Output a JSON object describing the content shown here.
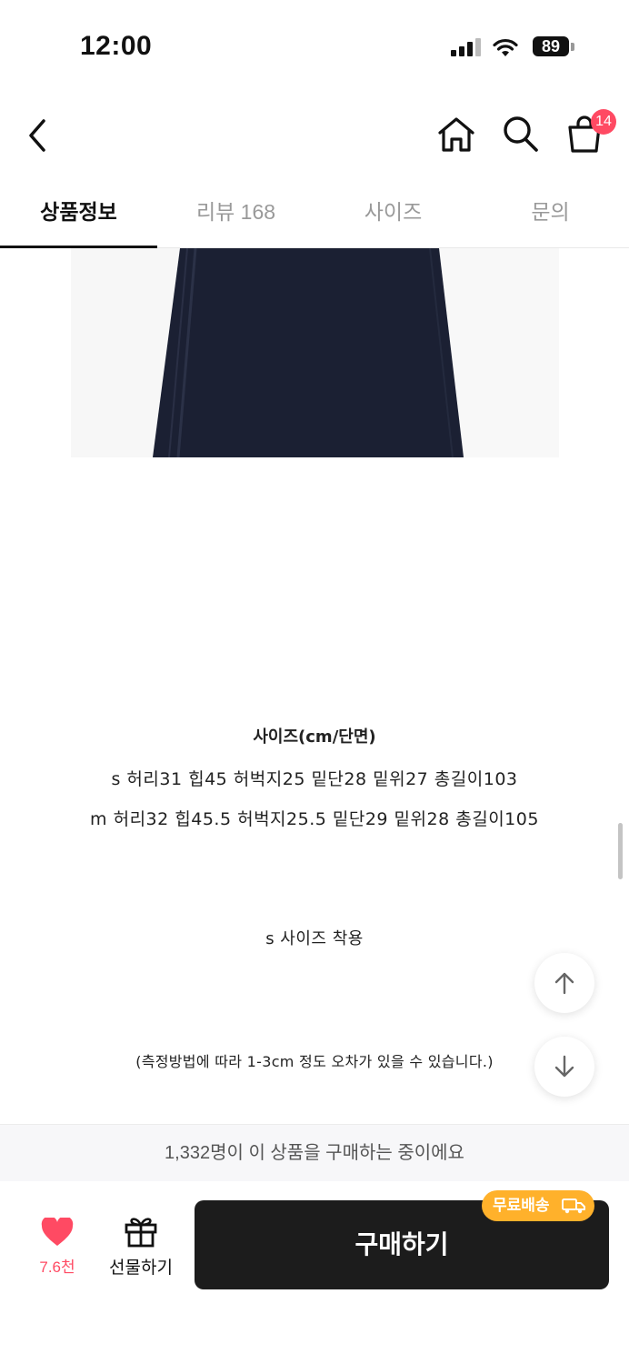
{
  "status_bar": {
    "time": "12:00",
    "battery": "89"
  },
  "header": {
    "cart_count": "14"
  },
  "tabs": [
    {
      "label": "상품정보",
      "active": true
    },
    {
      "label": "리뷰 168",
      "active": false
    },
    {
      "label": "사이즈",
      "active": false
    },
    {
      "label": "문의",
      "active": false
    }
  ],
  "content": {
    "size_title": "사이즈(cm/단면)",
    "size_rows": [
      "s 허리31 힙45 허벅지25 밑단28 밑위27 총길이103",
      "m 허리32 힙45.5 허벅지25.5 밑단29 밑위28 총길이105"
    ],
    "wearing_note": "s 사이즈 착용",
    "measure_note": "(측정방법에 따라 1-3cm 정도 오차가 있을 수 있습니다.)"
  },
  "purchase_notice": "1,332명이 이 상품을 구매하는 중이에요",
  "bottom_bar": {
    "like_count": "7.6천",
    "gift_label": "선물하기",
    "buy_label": "구매하기",
    "shipping_badge": "무료배송"
  },
  "colors": {
    "accent_pink": "#ff4a63",
    "shipping_orange": "#ffb12b",
    "buy_button": "#1c1c1c"
  }
}
